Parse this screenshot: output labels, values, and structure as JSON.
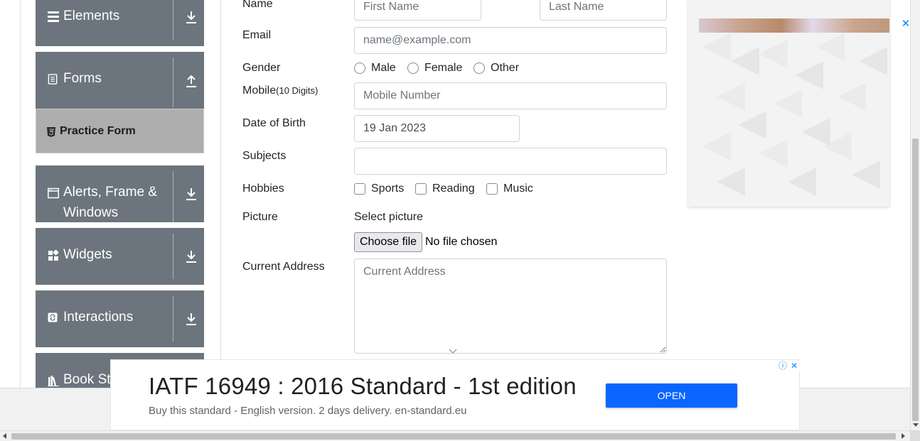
{
  "sidebar": {
    "groups": [
      {
        "label": "Elements",
        "icon": "list-icon",
        "arrow": "download-arrow-icon"
      },
      {
        "label": "Forms",
        "icon": "document-icon",
        "arrow": "upload-arrow-icon"
      },
      {
        "label": "Alerts, Frame &",
        "label2": "Windows",
        "icon": "window-icon",
        "arrow": "download-arrow-icon"
      },
      {
        "label": "Widgets",
        "icon": "widgets-icon",
        "arrow": "download-arrow-icon"
      },
      {
        "label": "Interactions",
        "icon": "interactions-icon",
        "arrow": "download-arrow-icon"
      },
      {
        "label": "Book St",
        "icon": "books-icon"
      }
    ],
    "active_item": {
      "label": "Practice Form",
      "icon": "html5-icon"
    }
  },
  "form": {
    "name_label": "Name",
    "first_name_placeholder": "First Name",
    "last_name_placeholder": "Last Name",
    "email_label": "Email",
    "email_placeholder": "name@example.com",
    "gender_label": "Gender",
    "gender_options": [
      "Male",
      "Female",
      "Other"
    ],
    "mobile_label": "Mobile",
    "mobile_hint": "(10 Digits)",
    "mobile_placeholder": "Mobile Number",
    "dob_label": "Date of Birth",
    "dob_value": "19 Jan 2023",
    "subjects_label": "Subjects",
    "subjects_value": "",
    "hobbies_label": "Hobbies",
    "hobbies_options": [
      "Sports",
      "Reading",
      "Music"
    ],
    "picture_label": "Picture",
    "select_picture": "Select picture",
    "choose_file": "Choose file",
    "no_file": "No file chosen",
    "address_label": "Current Address",
    "address_placeholder": "Current Address"
  },
  "bottom_ad": {
    "headline": "IATF 16949 : 2016 Standard - 1st edition",
    "subline": "Buy this standard - English version. 2 days delivery. en-standard.eu",
    "button": "OPEN",
    "info_glyph": "ⓘ",
    "close_glyph": "✕"
  },
  "side_ad": {
    "close_glyph": "✕"
  },
  "colors": {
    "sidebar_group": "#6c757d",
    "active_item": "#adadad",
    "ad_button": "#0a66ff"
  }
}
